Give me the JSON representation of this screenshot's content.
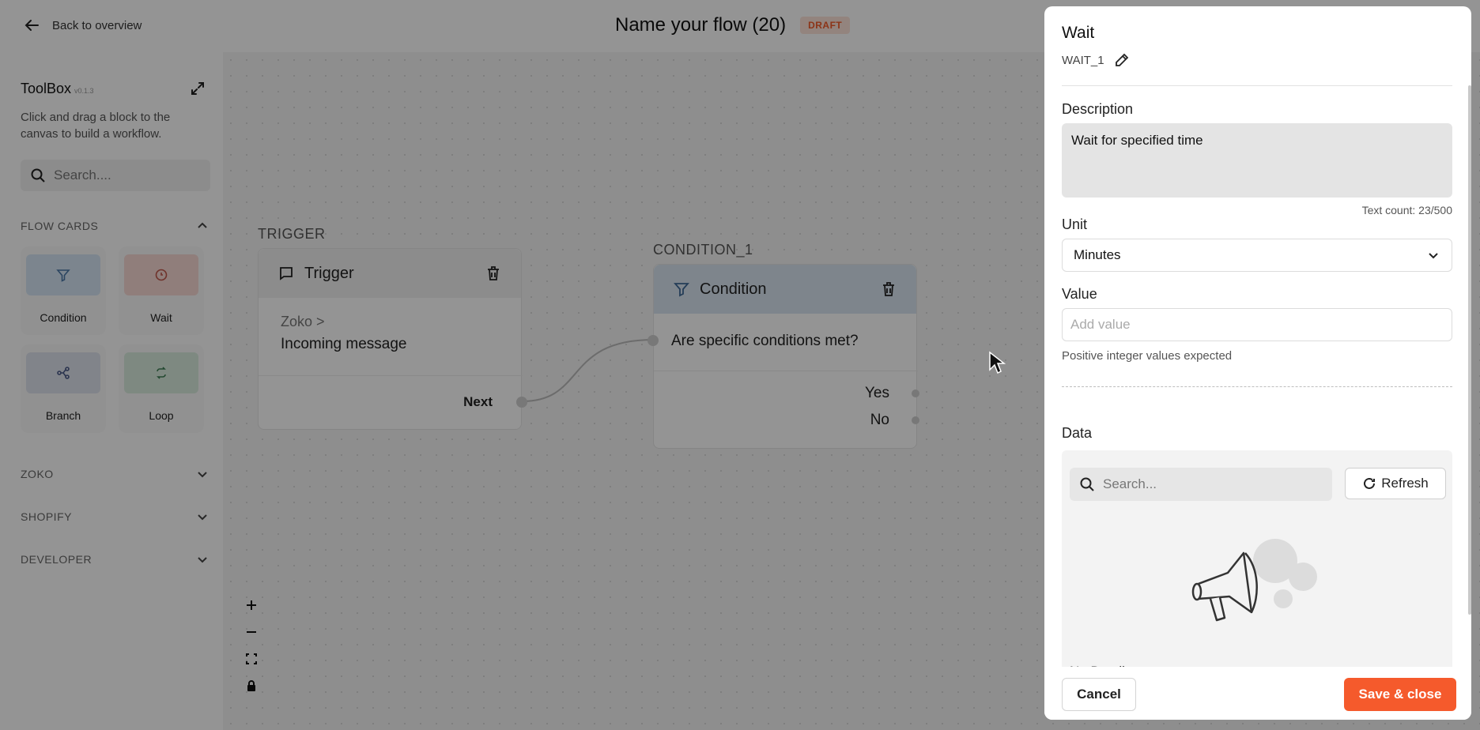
{
  "topbar": {
    "back_label": "Back to overview",
    "flow_title": "Name your flow (20)",
    "status_badge": "DRAFT"
  },
  "toolbox": {
    "title": "ToolBox",
    "version": "v0.1.3",
    "description": "Click and drag a block to the canvas to build a workflow.",
    "search_placeholder": "Search....",
    "sections": {
      "flow_cards": "FLOW CARDS",
      "zoko": "ZOKO",
      "shopify": "SHOPIFY",
      "developer": "DEVELOPER"
    },
    "cards": [
      {
        "label": "Condition",
        "icon": "filter-icon",
        "color": "#d6e6f5"
      },
      {
        "label": "Wait",
        "icon": "clock-icon",
        "color": "#f8d9d4"
      },
      {
        "label": "Branch",
        "icon": "branch-icon",
        "color": "#dfe3ee"
      },
      {
        "label": "Loop",
        "icon": "loop-icon",
        "color": "#d9ecdf"
      }
    ]
  },
  "canvas": {
    "trigger_node": {
      "caption": "TRIGGER",
      "title": "Trigger",
      "source": "Zoko >",
      "event": "Incoming message",
      "output_label": "Next"
    },
    "condition_node": {
      "caption": "CONDITION_1",
      "title": "Condition",
      "question": "Are specific conditions met?",
      "yes_label": "Yes",
      "no_label": "No"
    }
  },
  "panel": {
    "title": "Wait",
    "node_id": "WAIT_1",
    "description_label": "Description",
    "description_value": "Wait for specified time",
    "text_count": "Text count: 23/500",
    "unit_label": "Unit",
    "unit_value": "Minutes",
    "value_label": "Value",
    "value_placeholder": "Add value",
    "value_hint": "Positive integer values expected",
    "data_label": "Data",
    "data_search_placeholder": "Search...",
    "refresh_label": "Refresh",
    "empty_text": "No Detail",
    "cancel_label": "Cancel",
    "save_label": "Save & close",
    "accent_color": "#f55a2c"
  }
}
